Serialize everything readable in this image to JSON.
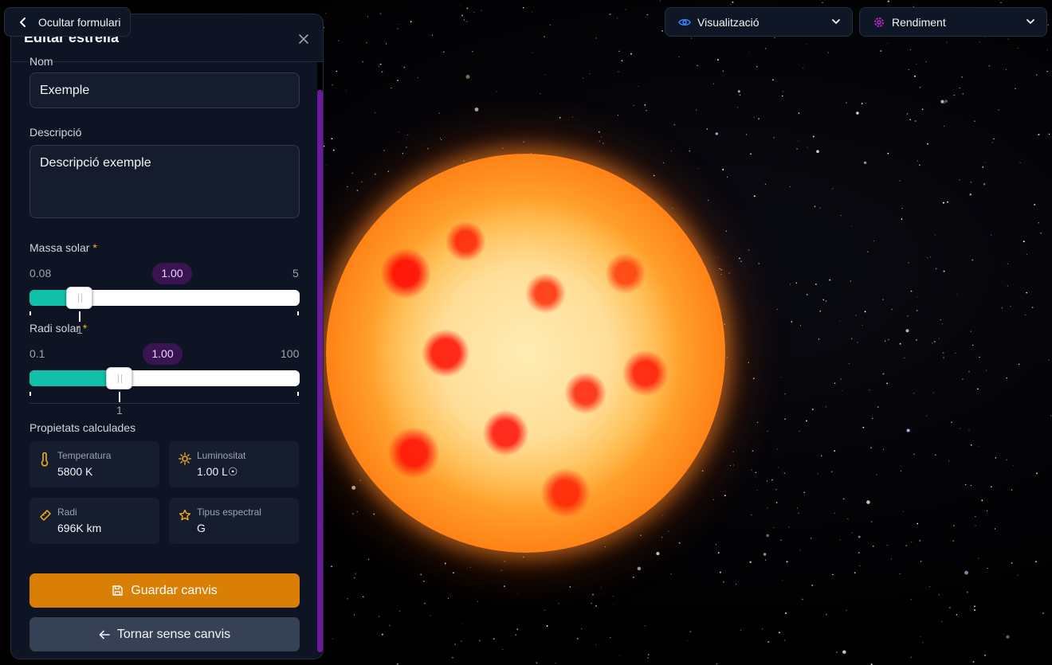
{
  "top_bar": {
    "hide_form_label": "Ocultar formulari",
    "visual_label": "Visualització",
    "performance_label": "Rendiment"
  },
  "panel": {
    "title": "Editar estrella",
    "name_label": "Nom",
    "name_value": "Exemple",
    "description_label": "Descripció",
    "description_value": "Descripció exemple",
    "mass": {
      "label": "Massa solar",
      "required_mark": "*",
      "min": "0.08",
      "max": "5",
      "value_display": "1.00",
      "value": 1.0,
      "tick_label": "1"
    },
    "radius": {
      "label": "Radi solar",
      "required_mark": "*",
      "min": "0.1",
      "max": "100",
      "value_display": "1.00",
      "value": 1.0,
      "tick_label": "1"
    },
    "computed_title": "Propietats calculades",
    "cards": [
      {
        "label": "Temperatura",
        "value": "5800 K",
        "icon": "thermometer-icon"
      },
      {
        "label": "Luminositat",
        "value": "1.00 L☉",
        "icon": "sun-icon"
      },
      {
        "label": "Radi",
        "value": "696K km",
        "icon": "ruler-icon"
      },
      {
        "label": "Tipus espectral",
        "value": "G",
        "icon": "star-icon"
      }
    ],
    "save_label": "Guardar canvis",
    "back_label": "Tornar sense canvis"
  },
  "colors": {
    "accent_teal": "#10c0a8",
    "accent_orange": "#d97f06",
    "accent_purple": "#a855f7",
    "panel_bg": "#0e1424"
  }
}
